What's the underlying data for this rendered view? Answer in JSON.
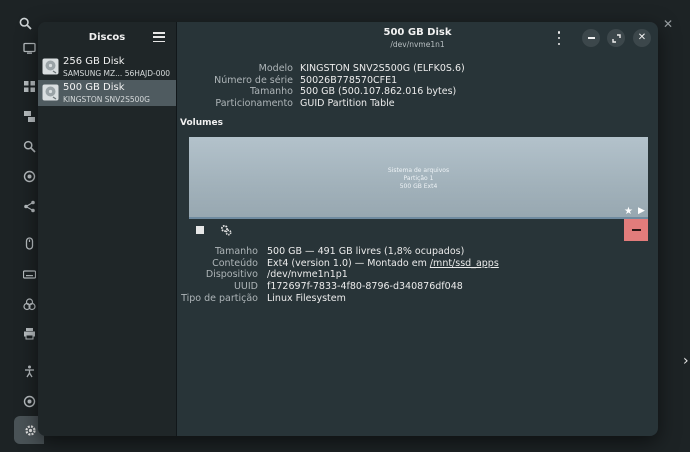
{
  "dialog": {
    "sidebar_title": "Discos",
    "disks": [
      {
        "name": "256 GB Disk",
        "model": "SAMSUNG MZ... 56HAJD-000",
        "selected": false
      },
      {
        "name": "500 GB Disk",
        "model": "KINGSTON SNV2S500G",
        "selected": true
      }
    ],
    "title": "500 GB Disk",
    "subtitle": "/dev/nvme1n1",
    "info": [
      {
        "label": "Modelo",
        "value": "KINGSTON SNV2S500G (ELFK0S.6)"
      },
      {
        "label": "Número de série",
        "value": "50026B778570CFE1"
      },
      {
        "label": "Tamanho",
        "value": "500 GB (500.107.862.016 bytes)"
      },
      {
        "label": "Particionamento",
        "value": "GUID Partition Table"
      }
    ],
    "volumes_title": "Volumes",
    "volume": {
      "line1": "Sistema de arquivos",
      "line2": "Partição 1",
      "line3": "500 GB Ext4"
    },
    "partition_info": [
      {
        "label": "Tamanho",
        "value": "500 GB — 491 GB livres (1,8% ocupados)"
      },
      {
        "label": "Conteúdo",
        "value": "Ext4 (version 1.0) — Montado em ",
        "link": "/mnt/ssd_apps"
      },
      {
        "label": "Dispositivo",
        "value": "/dev/nvme1n1p1"
      },
      {
        "label": "UUID",
        "value": "f172697f-7833-4f80-8796-d340876df048"
      },
      {
        "label": "Tipo de partição",
        "value": "Linux Filesystem"
      }
    ]
  },
  "icons": {
    "menu": "hamburger-icon",
    "kebab": "kebab-menu-icon",
    "minimize": "minimize-icon",
    "maximize": "maximize-icon",
    "close": "close-icon",
    "star": "star-icon",
    "play": "play-icon",
    "stop": "stop-icon",
    "gears": "gears-icon",
    "delete": "minus-icon"
  },
  "colors": {
    "dialog_bg": "#283438",
    "sidebar_bg": "#1f2628",
    "selected_row": "#4f5b60",
    "volume_fill": "#a1b1ba",
    "delete_button": "#e27c7b"
  }
}
